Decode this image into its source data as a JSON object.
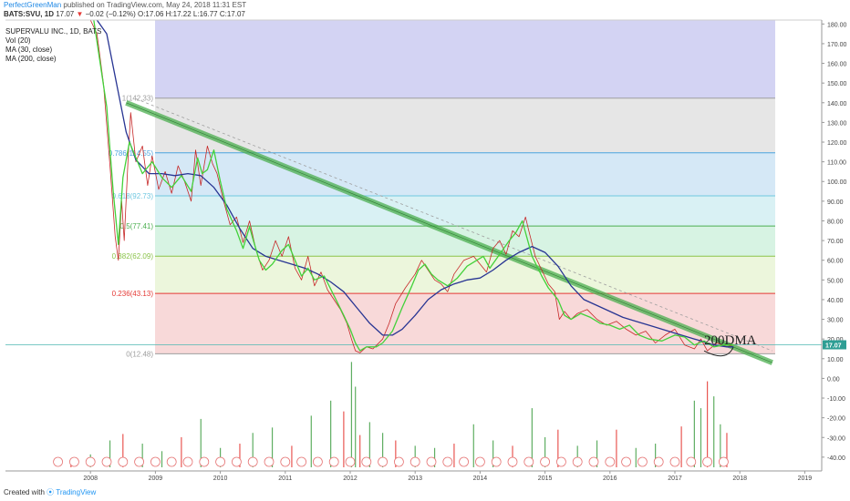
{
  "header": {
    "user": "PerfectGreenMan",
    "published": " published on TradingView.com, May 24, 2018 11:31 EST",
    "symbol": "BATS:SVU, 1D",
    "last": " 17.07",
    "change": " −0.02 (−0.12%)",
    "ohlc": " O:17.06 H:17.22 L:16.77 C:17.07"
  },
  "legend": {
    "title": "SUPERVALU INC., 1D, BATS",
    "items": [
      "Vol (20)",
      "MA (30, close)",
      "MA (200, close)"
    ]
  },
  "footer": {
    "created": "Created with",
    "brand": "TradingView"
  },
  "colors": {
    "price": "#c62828",
    "ma30": "#43d13a",
    "ma200": "#283593",
    "trend_band": "#4caf50",
    "dashed": "#9e9e9e"
  },
  "chart_data": {
    "type": "line",
    "price_axis": {
      "range": [
        -47,
        182
      ],
      "ticks": [
        "180.00",
        "170.00",
        "160.00",
        "150.00",
        "140.00",
        "130.00",
        "120.00",
        "110.00",
        "100.00",
        "90.00",
        "80.00",
        "70.00",
        "60.00",
        "50.00",
        "40.00",
        "30.00",
        "20.00",
        "10.00",
        "0.00",
        "-10.00",
        "-20.00",
        "-30.00",
        "-40.00"
      ],
      "last_price_label": "17.07"
    },
    "time_axis": {
      "ticks": [
        "2008",
        "2009",
        "2010",
        "2011",
        "2012",
        "2013",
        "2014",
        "2015",
        "2016",
        "2017",
        "2018",
        "2019"
      ]
    },
    "fibonacci": [
      {
        "level": "1",
        "value": 142.33,
        "label": "1(142.33)",
        "color": "#a0a0a0",
        "fill": "#e6e6e6"
      },
      {
        "level": "0.786",
        "value": 114.55,
        "label": "0.786(114.55)",
        "color": "#4aa3df",
        "fill": "#d5e8f6"
      },
      {
        "level": "0.618",
        "value": 92.73,
        "label": "0.618(92.73)",
        "color": "#6fc7e0",
        "fill": "#d9f1f4"
      },
      {
        "level": "0.5",
        "value": 77.41,
        "label": "0.5(77.41)",
        "color": "#4caf50",
        "fill": "#d7f3e3"
      },
      {
        "level": "0.382",
        "value": 62.09,
        "label": "0.382(62.09)",
        "color": "#8bc34a",
        "fill": "#ecf6dc"
      },
      {
        "level": "0.236",
        "value": 43.13,
        "label": "0.236(43.13)",
        "color": "#e53935",
        "fill": "#f8d9d9"
      },
      {
        "level": "0",
        "value": 12.48,
        "label": "0(12.48)",
        "color": "#9e9e9e",
        "fill": ""
      }
    ],
    "fib_top_zone": {
      "from": 142.33,
      "to": 182,
      "fill": "#d3d3f3"
    },
    "annotation": "200DMA",
    "series": [
      {
        "name": "MA (30, close)",
        "color": "#43d13a",
        "points": [
          [
            2008.55,
            183
          ],
          [
            2008.75,
            138
          ],
          [
            2008.85,
            95
          ],
          [
            2008.93,
            68
          ],
          [
            2009.0,
            102
          ],
          [
            2009.1,
            120
          ],
          [
            2009.2,
            112
          ],
          [
            2009.3,
            104
          ],
          [
            2009.45,
            110
          ],
          [
            2009.6,
            102
          ],
          [
            2009.75,
            97
          ],
          [
            2009.9,
            103
          ],
          [
            2010.05,
            95
          ],
          [
            2010.15,
            112
          ],
          [
            2010.22,
            104
          ],
          [
            2010.3,
            106
          ],
          [
            2010.4,
            116
          ],
          [
            2010.5,
            100
          ],
          [
            2010.6,
            86
          ],
          [
            2010.75,
            75
          ],
          [
            2010.85,
            66
          ],
          [
            2010.95,
            77
          ],
          [
            2011.0,
            71
          ],
          [
            2011.1,
            60
          ],
          [
            2011.2,
            55
          ],
          [
            2011.3,
            58
          ],
          [
            2011.45,
            65
          ],
          [
            2011.55,
            68
          ],
          [
            2011.65,
            60
          ],
          [
            2011.75,
            52
          ],
          [
            2011.85,
            56
          ],
          [
            2011.95,
            50
          ],
          [
            2012.1,
            52
          ],
          [
            2012.25,
            42
          ],
          [
            2012.4,
            32
          ],
          [
            2012.5,
            25
          ],
          [
            2012.58,
            18
          ],
          [
            2012.65,
            14
          ],
          [
            2012.75,
            16
          ],
          [
            2012.9,
            16
          ],
          [
            2013.0,
            18
          ],
          [
            2013.15,
            24
          ],
          [
            2013.3,
            36
          ],
          [
            2013.45,
            47
          ],
          [
            2013.55,
            55
          ],
          [
            2013.65,
            58
          ],
          [
            2013.75,
            53
          ],
          [
            2013.85,
            50
          ],
          [
            2014.0,
            47
          ],
          [
            2014.15,
            51
          ],
          [
            2014.3,
            57
          ],
          [
            2014.45,
            60
          ],
          [
            2014.55,
            62
          ],
          [
            2014.65,
            56
          ],
          [
            2014.8,
            63
          ],
          [
            2014.95,
            70
          ],
          [
            2015.05,
            74
          ],
          [
            2015.15,
            80
          ],
          [
            2015.3,
            62
          ],
          [
            2015.45,
            52
          ],
          [
            2015.55,
            46
          ],
          [
            2015.7,
            40
          ],
          [
            2015.8,
            32
          ],
          [
            2015.9,
            30
          ],
          [
            2016.05,
            33
          ],
          [
            2016.2,
            31
          ],
          [
            2016.35,
            28
          ],
          [
            2016.5,
            27
          ],
          [
            2016.65,
            25
          ],
          [
            2016.8,
            27
          ],
          [
            2016.95,
            22
          ],
          [
            2017.1,
            20
          ],
          [
            2017.3,
            19
          ],
          [
            2017.5,
            22
          ],
          [
            2017.65,
            21
          ],
          [
            2017.8,
            17
          ],
          [
            2017.95,
            19
          ],
          [
            2018.1,
            16
          ],
          [
            2018.25,
            17
          ],
          [
            2018.4,
            17
          ]
        ]
      },
      {
        "name": "MA (200, close)",
        "color": "#283593",
        "points": [
          [
            2008.6,
            183
          ],
          [
            2008.75,
            175
          ],
          [
            2008.9,
            150
          ],
          [
            2009.05,
            125
          ],
          [
            2009.2,
            111
          ],
          [
            2009.4,
            104
          ],
          [
            2009.6,
            104
          ],
          [
            2009.8,
            103
          ],
          [
            2010.0,
            104
          ],
          [
            2010.2,
            103
          ],
          [
            2010.4,
            97
          ],
          [
            2010.6,
            88
          ],
          [
            2010.8,
            76
          ],
          [
            2011.0,
            66
          ],
          [
            2011.2,
            62
          ],
          [
            2011.4,
            60
          ],
          [
            2011.6,
            58
          ],
          [
            2011.8,
            56
          ],
          [
            2012.0,
            53
          ],
          [
            2012.2,
            49
          ],
          [
            2012.4,
            44
          ],
          [
            2012.6,
            36
          ],
          [
            2012.8,
            28
          ],
          [
            2013.0,
            22
          ],
          [
            2013.15,
            22
          ],
          [
            2013.3,
            25
          ],
          [
            2013.5,
            32
          ],
          [
            2013.7,
            40
          ],
          [
            2013.9,
            45
          ],
          [
            2014.1,
            48
          ],
          [
            2014.3,
            50
          ],
          [
            2014.5,
            51
          ],
          [
            2014.7,
            55
          ],
          [
            2014.9,
            60
          ],
          [
            2015.1,
            64
          ],
          [
            2015.3,
            67
          ],
          [
            2015.5,
            64
          ],
          [
            2015.7,
            57
          ],
          [
            2015.9,
            47
          ],
          [
            2016.1,
            40
          ],
          [
            2016.3,
            37
          ],
          [
            2016.5,
            34
          ],
          [
            2016.7,
            31
          ],
          [
            2016.9,
            29
          ],
          [
            2017.1,
            27
          ],
          [
            2017.3,
            25
          ],
          [
            2017.5,
            23
          ],
          [
            2017.7,
            21
          ],
          [
            2017.9,
            19
          ],
          [
            2018.1,
            17
          ],
          [
            2018.3,
            16
          ],
          [
            2018.4,
            16
          ]
        ]
      },
      {
        "color": "#c62828",
        "points": [
          [
            2008.5,
            184
          ],
          [
            2008.6,
            175
          ],
          [
            2008.7,
            150
          ],
          [
            2008.8,
            108
          ],
          [
            2008.88,
            72
          ],
          [
            2008.93,
            60
          ],
          [
            2008.98,
            90
          ],
          [
            2009.02,
            70
          ],
          [
            2009.08,
            112
          ],
          [
            2009.12,
            135
          ],
          [
            2009.2,
            110
          ],
          [
            2009.3,
            118
          ],
          [
            2009.38,
            98
          ],
          [
            2009.45,
            113
          ],
          [
            2009.55,
            96
          ],
          [
            2009.65,
            105
          ],
          [
            2009.75,
            94
          ],
          [
            2009.85,
            108
          ],
          [
            2009.95,
            100
          ],
          [
            2010.05,
            90
          ],
          [
            2010.12,
            116
          ],
          [
            2010.2,
            98
          ],
          [
            2010.3,
            118
          ],
          [
            2010.38,
            109
          ],
          [
            2010.45,
            104
          ],
          [
            2010.55,
            90
          ],
          [
            2010.65,
            78
          ],
          [
            2010.75,
            82
          ],
          [
            2010.85,
            69
          ],
          [
            2010.95,
            80
          ],
          [
            2011.05,
            65
          ],
          [
            2011.15,
            55
          ],
          [
            2011.25,
            60
          ],
          [
            2011.35,
            70
          ],
          [
            2011.45,
            62
          ],
          [
            2011.55,
            72
          ],
          [
            2011.65,
            56
          ],
          [
            2011.75,
            50
          ],
          [
            2011.85,
            62
          ],
          [
            2011.95,
            47
          ],
          [
            2012.05,
            54
          ],
          [
            2012.15,
            45
          ],
          [
            2012.25,
            40
          ],
          [
            2012.35,
            35
          ],
          [
            2012.45,
            28
          ],
          [
            2012.52,
            20
          ],
          [
            2012.58,
            14
          ],
          [
            2012.65,
            13
          ],
          [
            2012.75,
            16
          ],
          [
            2012.85,
            15
          ],
          [
            2013.0,
            20
          ],
          [
            2013.1,
            28
          ],
          [
            2013.2,
            38
          ],
          [
            2013.35,
            46
          ],
          [
            2013.5,
            53
          ],
          [
            2013.6,
            60
          ],
          [
            2013.7,
            55
          ],
          [
            2013.8,
            50
          ],
          [
            2013.9,
            48
          ],
          [
            2014.0,
            44
          ],
          [
            2014.1,
            53
          ],
          [
            2014.25,
            60
          ],
          [
            2014.4,
            62
          ],
          [
            2014.5,
            58
          ],
          [
            2014.6,
            54
          ],
          [
            2014.7,
            66
          ],
          [
            2014.8,
            70
          ],
          [
            2014.9,
            63
          ],
          [
            2015.0,
            75
          ],
          [
            2015.1,
            72
          ],
          [
            2015.2,
            82
          ],
          [
            2015.25,
            75
          ],
          [
            2015.35,
            62
          ],
          [
            2015.45,
            55
          ],
          [
            2015.55,
            48
          ],
          [
            2015.65,
            44
          ],
          [
            2015.72,
            30
          ],
          [
            2015.8,
            34
          ],
          [
            2015.9,
            30
          ],
          [
            2016.0,
            33
          ],
          [
            2016.15,
            35
          ],
          [
            2016.3,
            30
          ],
          [
            2016.45,
            27
          ],
          [
            2016.6,
            29
          ],
          [
            2016.75,
            25
          ],
          [
            2016.9,
            22
          ],
          [
            2017.05,
            24
          ],
          [
            2017.2,
            18
          ],
          [
            2017.35,
            22
          ],
          [
            2017.5,
            25
          ],
          [
            2017.65,
            17
          ],
          [
            2017.8,
            15
          ],
          [
            2017.9,
            20
          ],
          [
            2018.0,
            14
          ],
          [
            2018.15,
            18
          ],
          [
            2018.3,
            16
          ],
          [
            2018.4,
            17
          ]
        ]
      }
    ],
    "trend_band": {
      "from": [
        2009.05,
        140
      ],
      "to": [
        2019.0,
        8
      ],
      "thickness": 6
    },
    "dashed_trend": {
      "from": [
        2009.2,
        142
      ],
      "to": [
        2019.0,
        14
      ]
    },
    "volume": {
      "scale_max": 10,
      "bars": [
        [
          2008.2,
          0.8
        ],
        [
          2008.5,
          1.2
        ],
        [
          2008.8,
          2.5
        ],
        [
          2009.0,
          3.1
        ],
        [
          2009.3,
          2.2
        ],
        [
          2009.6,
          1.5
        ],
        [
          2009.9,
          2.8
        ],
        [
          2010.2,
          4.5
        ],
        [
          2010.5,
          1.8
        ],
        [
          2010.8,
          2.2
        ],
        [
          2011.0,
          3.2
        ],
        [
          2011.3,
          3.7
        ],
        [
          2011.6,
          2.0
        ],
        [
          2011.9,
          4.8
        ],
        [
          2012.2,
          6.2
        ],
        [
          2012.4,
          5.2
        ],
        [
          2012.52,
          9.8
        ],
        [
          2012.58,
          7.5
        ],
        [
          2012.65,
          3.0
        ],
        [
          2012.8,
          4.2
        ],
        [
          2013.0,
          3.2
        ],
        [
          2013.2,
          2.5
        ],
        [
          2013.5,
          2.0
        ],
        [
          2013.8,
          1.8
        ],
        [
          2014.1,
          2.2
        ],
        [
          2014.4,
          4.0
        ],
        [
          2014.7,
          2.5
        ],
        [
          2015.0,
          2.0
        ],
        [
          2015.3,
          5.5
        ],
        [
          2015.5,
          2.8
        ],
        [
          2015.7,
          3.5
        ],
        [
          2016.0,
          2.0
        ],
        [
          2016.3,
          2.5
        ],
        [
          2016.6,
          3.5
        ],
        [
          2016.9,
          1.8
        ],
        [
          2017.2,
          2.2
        ],
        [
          2017.6,
          3.8
        ],
        [
          2017.8,
          6.2
        ],
        [
          2017.9,
          5.5
        ],
        [
          2018.0,
          8.0
        ],
        [
          2018.1,
          6.6
        ],
        [
          2018.2,
          4.0
        ],
        [
          2018.3,
          3.2
        ]
      ]
    }
  }
}
